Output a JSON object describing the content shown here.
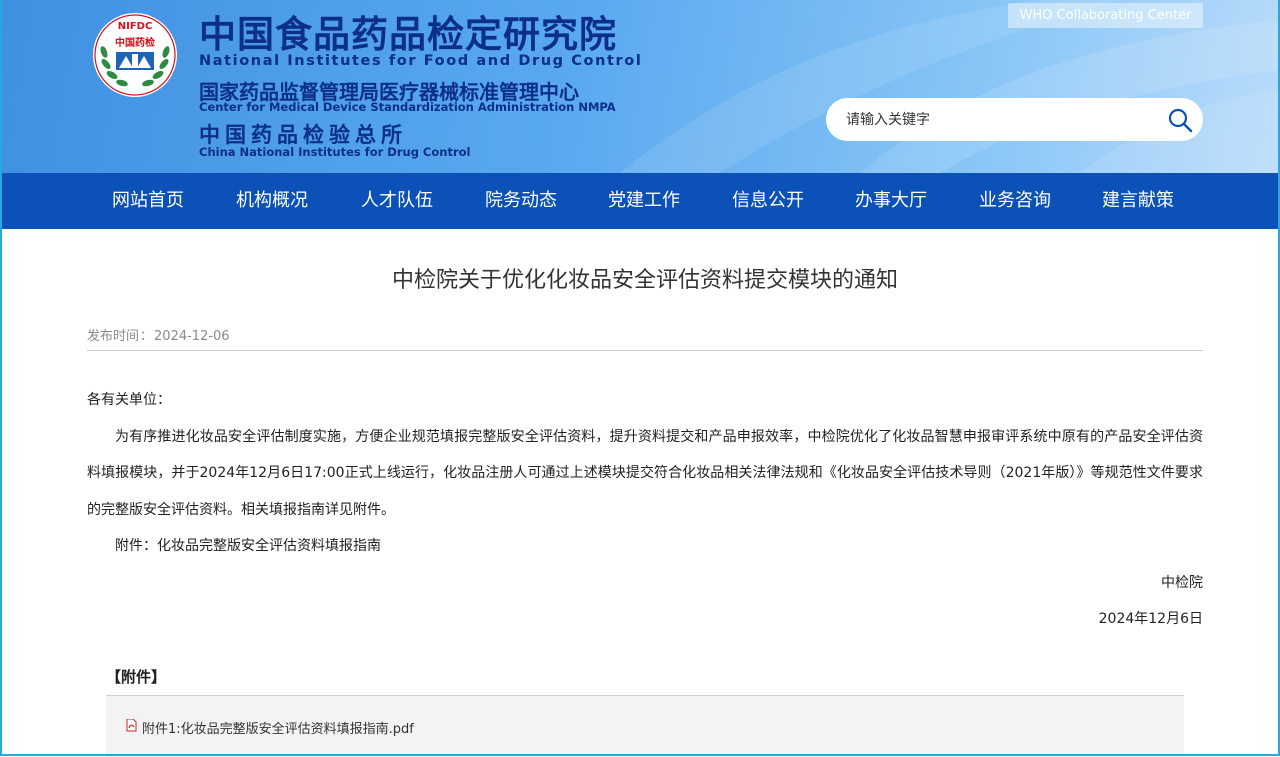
{
  "header": {
    "logo_ring_text": "NIFDC",
    "logo_center_text": "中国药检",
    "title_cn": "中国食品药品检定研究院",
    "title_en": "National Institutes for Food and Drug Control",
    "subtitle_cn": "国家药品监督管理局医疗器械标准管理中心",
    "subtitle_en": "Center for Medical Device Standardization Administration NMPA",
    "third_cn": "中国药品检验总所",
    "third_en": "China National Institutes for Drug Control",
    "who_badge": "WHO Collaborating Center",
    "search": {
      "placeholder": "请输入关键字",
      "value": ""
    },
    "colors": {
      "brand_navy": "#0b2f8a",
      "nav_blue": "#0b51b7",
      "header_blue": "#4a9ae6",
      "logo_red": "#d0121b",
      "logo_green": "#2d8a3e"
    }
  },
  "nav": {
    "items": [
      "网站首页",
      "机构概况",
      "人才队伍",
      "院务动态",
      "党建工作",
      "信息公开",
      "办事大厅",
      "业务咨询",
      "建言献策"
    ]
  },
  "article": {
    "title": "中检院关于优化化妆品安全评估资料提交模块的通知",
    "publish_label": "发布时间",
    "publish_sep": "：",
    "publish_date": "2024-12-06",
    "greeting": "各有关单位：",
    "body": "为有序推进化妆品安全评估制度实施，方便企业规范填报完整版安全评估资料，提升资料提交和产品申报效率，中检院优化了化妆品智慧申报审评系统中原有的产品安全评估资料填报模块，并于2024年12月6日17:00正式上线运行，化妆品注册人可通过上述模块提交符合化妆品相关法律法规和《化妆品安全评估技术导则（2021年版）》等规范性文件要求的完整版安全评估资料。相关填报指南详见附件。",
    "attachment_note": "附件：化妆品完整版安全评估资料填报指南",
    "signature": "中检院",
    "sign_date": "2024年12月6日"
  },
  "attachments": {
    "heading": "【附件】",
    "items": [
      {
        "label": "附件1:化妆品完整版安全评估资料填报指南.pdf",
        "icon": "pdf-icon"
      }
    ]
  }
}
